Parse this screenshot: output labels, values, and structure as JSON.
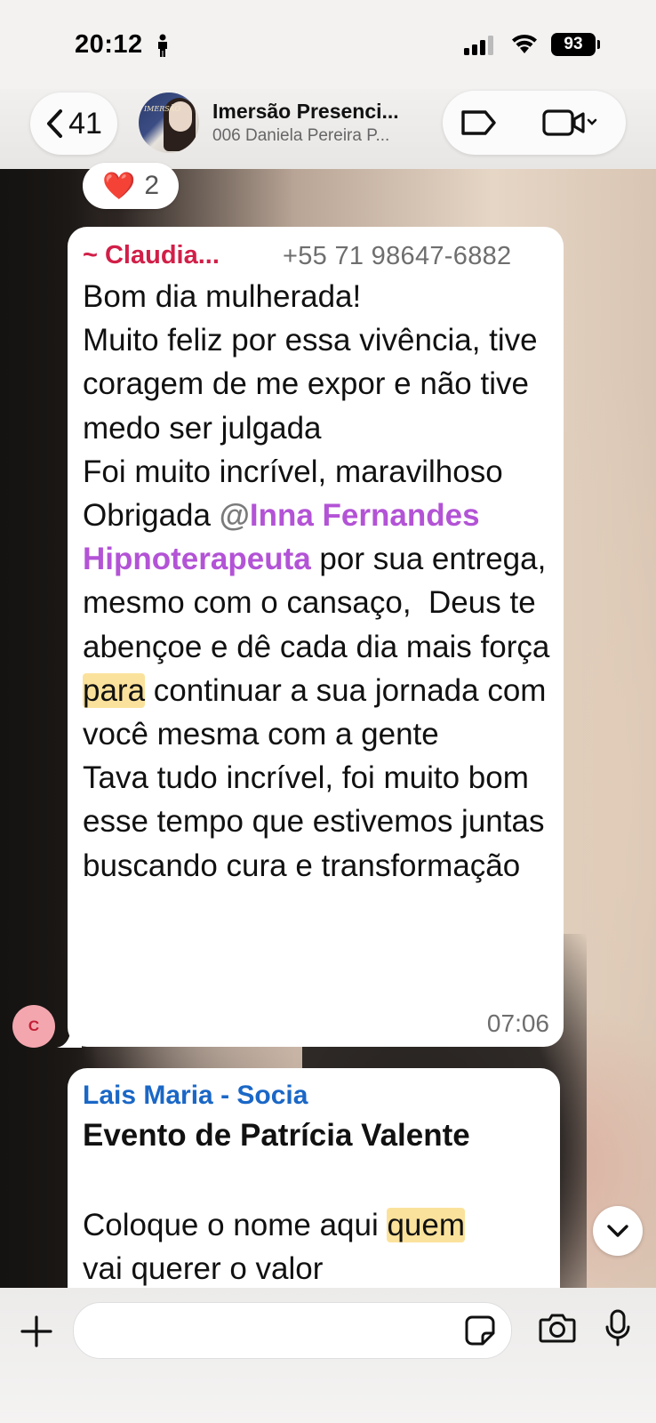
{
  "status_bar": {
    "time": "20:12",
    "battery": "93"
  },
  "header": {
    "back_count": "41",
    "title": "Imersão Presenci...",
    "subtitle": "006 Daniela Pereira P...",
    "avatar_text": "IMERSÃO"
  },
  "reaction": {
    "emoji": "❤️",
    "count": "2"
  },
  "message1": {
    "sender": "~ Claudia...",
    "phone": "+55 71 98647-6882",
    "text_before_mention": "Bom dia mulherada!\nMuito feliz por essa vivência, tive coragem de me expor e não tive medo ser julgada\nFoi muito incrível, maravilhoso\nObrigada ",
    "mention_at": "@",
    "mention": "Inna Fernandes Hipnoterapeuta",
    "text_after_mention": " por sua entrega, mesmo com o cansaço,  Deus te abençoe e dê cada dia mais força ",
    "highlight": "para",
    "text_end": " continuar a sua jornada com você mesma com a gente\nTava tudo incrível, foi muito bom esse tempo que estivemos juntas buscando cura e transformação",
    "time": "07:06",
    "avatar_letter": "C"
  },
  "message2": {
    "sender": "Lais Maria - Socia",
    "title": "Evento de Patrícia Valente",
    "text_before": "Coloque o nome aqui ",
    "highlight": "quem",
    "text_after": "\nvai querer o valor"
  },
  "colors": {
    "sender1": "#d11f48",
    "sender2": "#1a67c6",
    "mention": "#b353d6",
    "highlight": "#fbe29c"
  }
}
